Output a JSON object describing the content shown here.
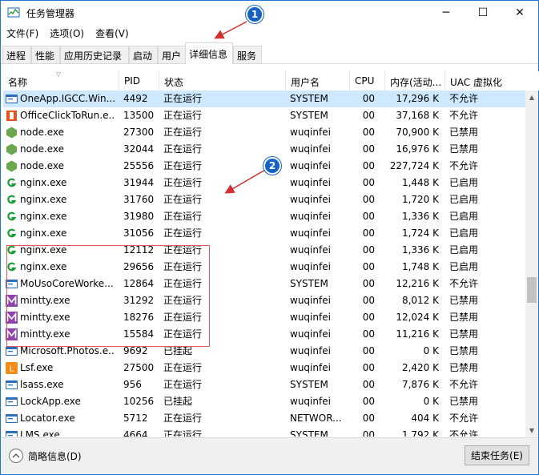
{
  "window": {
    "title": "任务管理器",
    "minimize_glyph": "─",
    "maximize_glyph": "☐",
    "close_glyph": "✕"
  },
  "menu": [
    "文件(F)",
    "选项(O)",
    "查看(V)"
  ],
  "tabs": [
    {
      "label": "进程"
    },
    {
      "label": "性能"
    },
    {
      "label": "应用历史记录"
    },
    {
      "label": "启动"
    },
    {
      "label": "用户"
    },
    {
      "label": "详细信息",
      "active": true
    },
    {
      "label": "服务"
    }
  ],
  "columns": {
    "name": "名称",
    "pid": "PID",
    "status": "状态",
    "user": "用户名",
    "cpu": "CPU",
    "memory": "内存(活动...",
    "uac": "UAC 虚拟化"
  },
  "rows": [
    {
      "name": "OneApp.IGCC.Win...",
      "pid": "4492",
      "status": "正在运行",
      "user": "SYSTEM",
      "cpu": "00",
      "memory": "17,296 K",
      "uac": "不允许",
      "icon": "app-window-icon",
      "selected": true
    },
    {
      "name": "OfficeClickToRun.e...",
      "pid": "13500",
      "status": "正在运行",
      "user": "SYSTEM",
      "cpu": "00",
      "memory": "37,168 K",
      "uac": "不允许",
      "icon": "office-icon"
    },
    {
      "name": "node.exe",
      "pid": "27300",
      "status": "正在运行",
      "user": "wuqinfei",
      "cpu": "00",
      "memory": "70,900 K",
      "uac": "已禁用",
      "icon": "nodejs-icon"
    },
    {
      "name": "node.exe",
      "pid": "32044",
      "status": "正在运行",
      "user": "wuqinfei",
      "cpu": "00",
      "memory": "16,976 K",
      "uac": "已禁用",
      "icon": "nodejs-icon"
    },
    {
      "name": "node.exe",
      "pid": "25556",
      "status": "正在运行",
      "user": "wuqinfei",
      "cpu": "00",
      "memory": "227,724 K",
      "uac": "不允许",
      "icon": "nodejs-icon"
    },
    {
      "name": "nginx.exe",
      "pid": "31944",
      "status": "正在运行",
      "user": "wuqinfei",
      "cpu": "00",
      "memory": "1,448 K",
      "uac": "已启用",
      "icon": "nginx-icon"
    },
    {
      "name": "nginx.exe",
      "pid": "31760",
      "status": "正在运行",
      "user": "wuqinfei",
      "cpu": "00",
      "memory": "1,720 K",
      "uac": "已启用",
      "icon": "nginx-icon"
    },
    {
      "name": "nginx.exe",
      "pid": "31980",
      "status": "正在运行",
      "user": "wuqinfei",
      "cpu": "00",
      "memory": "1,336 K",
      "uac": "已启用",
      "icon": "nginx-icon"
    },
    {
      "name": "nginx.exe",
      "pid": "31056",
      "status": "正在运行",
      "user": "wuqinfei",
      "cpu": "00",
      "memory": "1,724 K",
      "uac": "已启用",
      "icon": "nginx-icon"
    },
    {
      "name": "nginx.exe",
      "pid": "12112",
      "status": "正在运行",
      "user": "wuqinfei",
      "cpu": "00",
      "memory": "1,336 K",
      "uac": "已启用",
      "icon": "nginx-icon"
    },
    {
      "name": "nginx.exe",
      "pid": "29656",
      "status": "正在运行",
      "user": "wuqinfei",
      "cpu": "00",
      "memory": "1,748 K",
      "uac": "已启用",
      "icon": "nginx-icon"
    },
    {
      "name": "MoUsoCoreWorke...",
      "pid": "12864",
      "status": "正在运行",
      "user": "SYSTEM",
      "cpu": "00",
      "memory": "12,216 K",
      "uac": "不允许",
      "icon": "app-window-icon"
    },
    {
      "name": "mintty.exe",
      "pid": "31292",
      "status": "正在运行",
      "user": "wuqinfei",
      "cpu": "00",
      "memory": "8,012 K",
      "uac": "已禁用",
      "icon": "mintty-icon"
    },
    {
      "name": "mintty.exe",
      "pid": "18276",
      "status": "正在运行",
      "user": "wuqinfei",
      "cpu": "00",
      "memory": "12,024 K",
      "uac": "已禁用",
      "icon": "mintty-icon"
    },
    {
      "name": "mintty.exe",
      "pid": "15584",
      "status": "正在运行",
      "user": "wuqinfei",
      "cpu": "00",
      "memory": "11,216 K",
      "uac": "已禁用",
      "icon": "mintty-icon"
    },
    {
      "name": "Microsoft.Photos.e...",
      "pid": "9692",
      "status": "已挂起",
      "user": "wuqinfei",
      "cpu": "00",
      "memory": "0 K",
      "uac": "已禁用",
      "icon": "app-window-icon"
    },
    {
      "name": "Lsf.exe",
      "pid": "27500",
      "status": "正在运行",
      "user": "wuqinfei",
      "cpu": "00",
      "memory": "2,420 K",
      "uac": "已禁用",
      "icon": "lsf-icon"
    },
    {
      "name": "lsass.exe",
      "pid": "956",
      "status": "正在运行",
      "user": "SYSTEM",
      "cpu": "00",
      "memory": "7,876 K",
      "uac": "不允许",
      "icon": "app-window-icon"
    },
    {
      "name": "LockApp.exe",
      "pid": "10256",
      "status": "已挂起",
      "user": "wuqinfei",
      "cpu": "00",
      "memory": "0 K",
      "uac": "已禁用",
      "icon": "app-window-icon"
    },
    {
      "name": "Locator.exe",
      "pid": "5712",
      "status": "正在运行",
      "user": "NETWOR...",
      "cpu": "00",
      "memory": "404 K",
      "uac": "不允许",
      "icon": "app-window-icon"
    },
    {
      "name": "LMS.exe",
      "pid": "4664",
      "status": "正在运行",
      "user": "SYSTEM",
      "cpu": "00",
      "memory": "1,792 K",
      "uac": "不允许",
      "icon": "app-window-icon"
    }
  ],
  "footer": {
    "less_details": "简略信息(D)",
    "end_task": "结束任务(E)"
  },
  "callouts": [
    "1",
    "2"
  ],
  "colors": {
    "accent": "#1662c4",
    "highlight_box": "#e05c5c",
    "selection": "#cde8ff",
    "nginx_green": "#1a9c3a",
    "node_green": "#6aa84f",
    "mintty_purple": "#8e44ad",
    "office_orange": "#e8501c",
    "lsf_orange": "#f28c1a"
  }
}
